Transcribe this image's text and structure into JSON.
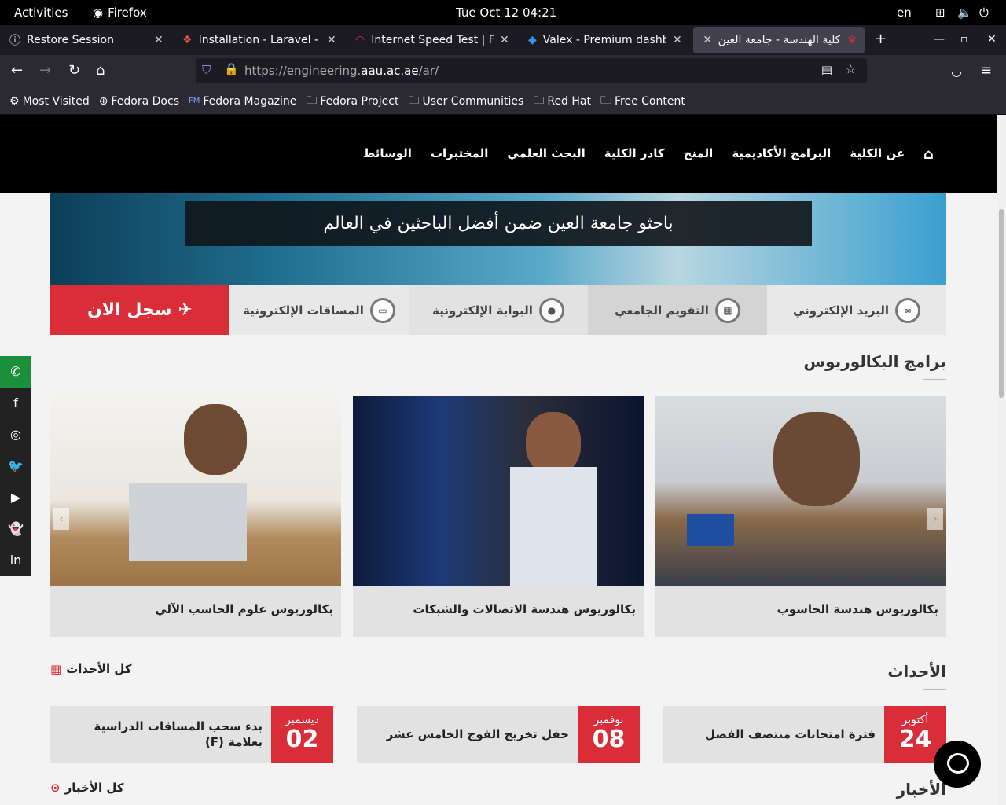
{
  "gnome": {
    "activities": "Activities",
    "app": "Firefox",
    "clock": "Tue Oct 12  04:21",
    "lang": "en"
  },
  "tabs": [
    {
      "label": "Restore Session",
      "icon": "info-icon"
    },
    {
      "label": "Installation - Laravel - Th",
      "icon": "laravel-icon"
    },
    {
      "label": "Internet Speed Test | Fast",
      "icon": "speedometer-icon"
    },
    {
      "label": "Valex - Premium dashboa",
      "icon": "valex-icon"
    },
    {
      "label": "كلية الهندسة - جامعة العين",
      "icon": "university-icon",
      "active": true
    }
  ],
  "url": {
    "prefix": "https://engineering.",
    "domain": "aau.ac.ae",
    "path": "/ar/"
  },
  "bookmarks": [
    "Most Visited",
    "Fedora Docs",
    "Fedora Magazine",
    "Fedora Project",
    "User Communities",
    "Red Hat",
    "Free Content"
  ],
  "site": {
    "menu": [
      "عن الكلية",
      "البرامج الأكاديمية",
      "المنح",
      "كادر الكلية",
      "البحث العلمي",
      "المختبرات",
      "الوسائط"
    ],
    "hero_caption": "باحثو جامعة العين ضمن أفضل الباحثين في العالم",
    "quick_links": [
      "البريد الإلكتروني",
      "التقويم الجامعي",
      "البوابة الإلكترونية",
      "المساقات الإلكترونية",
      "سجل الان"
    ],
    "programs_heading": "برامج البكالوريوس",
    "programs": [
      "بكالوريوس هندسة الحاسوب",
      "بكالوريوس هندسة الاتصالات والشبكات",
      "بكالوريوس علوم الحاسب الآلي"
    ],
    "events_heading": "الأحداث",
    "all_events": "كل الأحداث",
    "events": [
      {
        "month": "أكتوبر",
        "day": "24",
        "title": "فترة امتحانات منتصف الفصل"
      },
      {
        "month": "نوفمبر",
        "day": "08",
        "title": "حفل تخريج الفوج الخامس عشر"
      },
      {
        "month": "ديسمبر",
        "day": "02",
        "title": "بدء سحب المساقات الدراسية بعلامة (F)"
      }
    ],
    "news_heading": "الأخبار",
    "all_news": "كل الأخبار"
  },
  "colors": {
    "accent_red": "#d92d3a",
    "nav_black": "#000000",
    "whatsapp_green": "#1b8f3c"
  }
}
